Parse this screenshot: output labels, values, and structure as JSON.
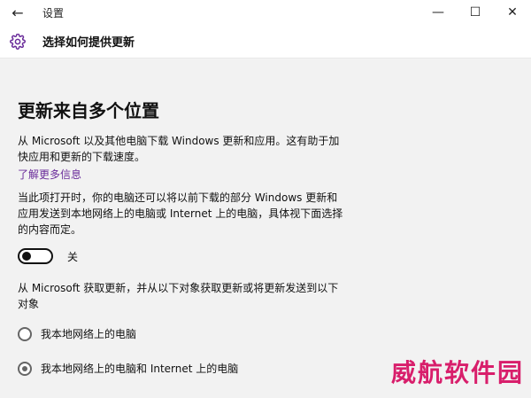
{
  "window": {
    "title": "设置",
    "controls": {
      "minimize": "—",
      "maximize": "☐",
      "close": "✕"
    }
  },
  "header": {
    "title": "选择如何提供更新",
    "icon": "gear-icon"
  },
  "main": {
    "heading": "更新来自多个位置",
    "description": "从 Microsoft 以及其他电脑下载 Windows 更新和应用。这有助于加快应用和更新的下载速度。",
    "learn_more": "了解更多信息",
    "when_on": "当此项打开时，你的电脑还可以将以前下载的部分 Windows 更新和应用发送到本地网络上的电脑或 Internet 上的电脑，具体视下面选择的内容而定。",
    "toggle": {
      "state": "off",
      "label": "关"
    },
    "get_updates_text": "从 Microsoft 获取更新，并从以下对象获取更新或将更新发送到以下对象",
    "options": [
      {
        "label": "我本地网络上的电脑",
        "selected": false
      },
      {
        "label": "我本地网络上的电脑和 Internet 上的电脑",
        "selected": true
      }
    ]
  },
  "watermark": "威航软件园",
  "colors": {
    "link": "#6a2c9a",
    "watermark": "#d81e6b",
    "content_bg": "#f2f2f2"
  }
}
